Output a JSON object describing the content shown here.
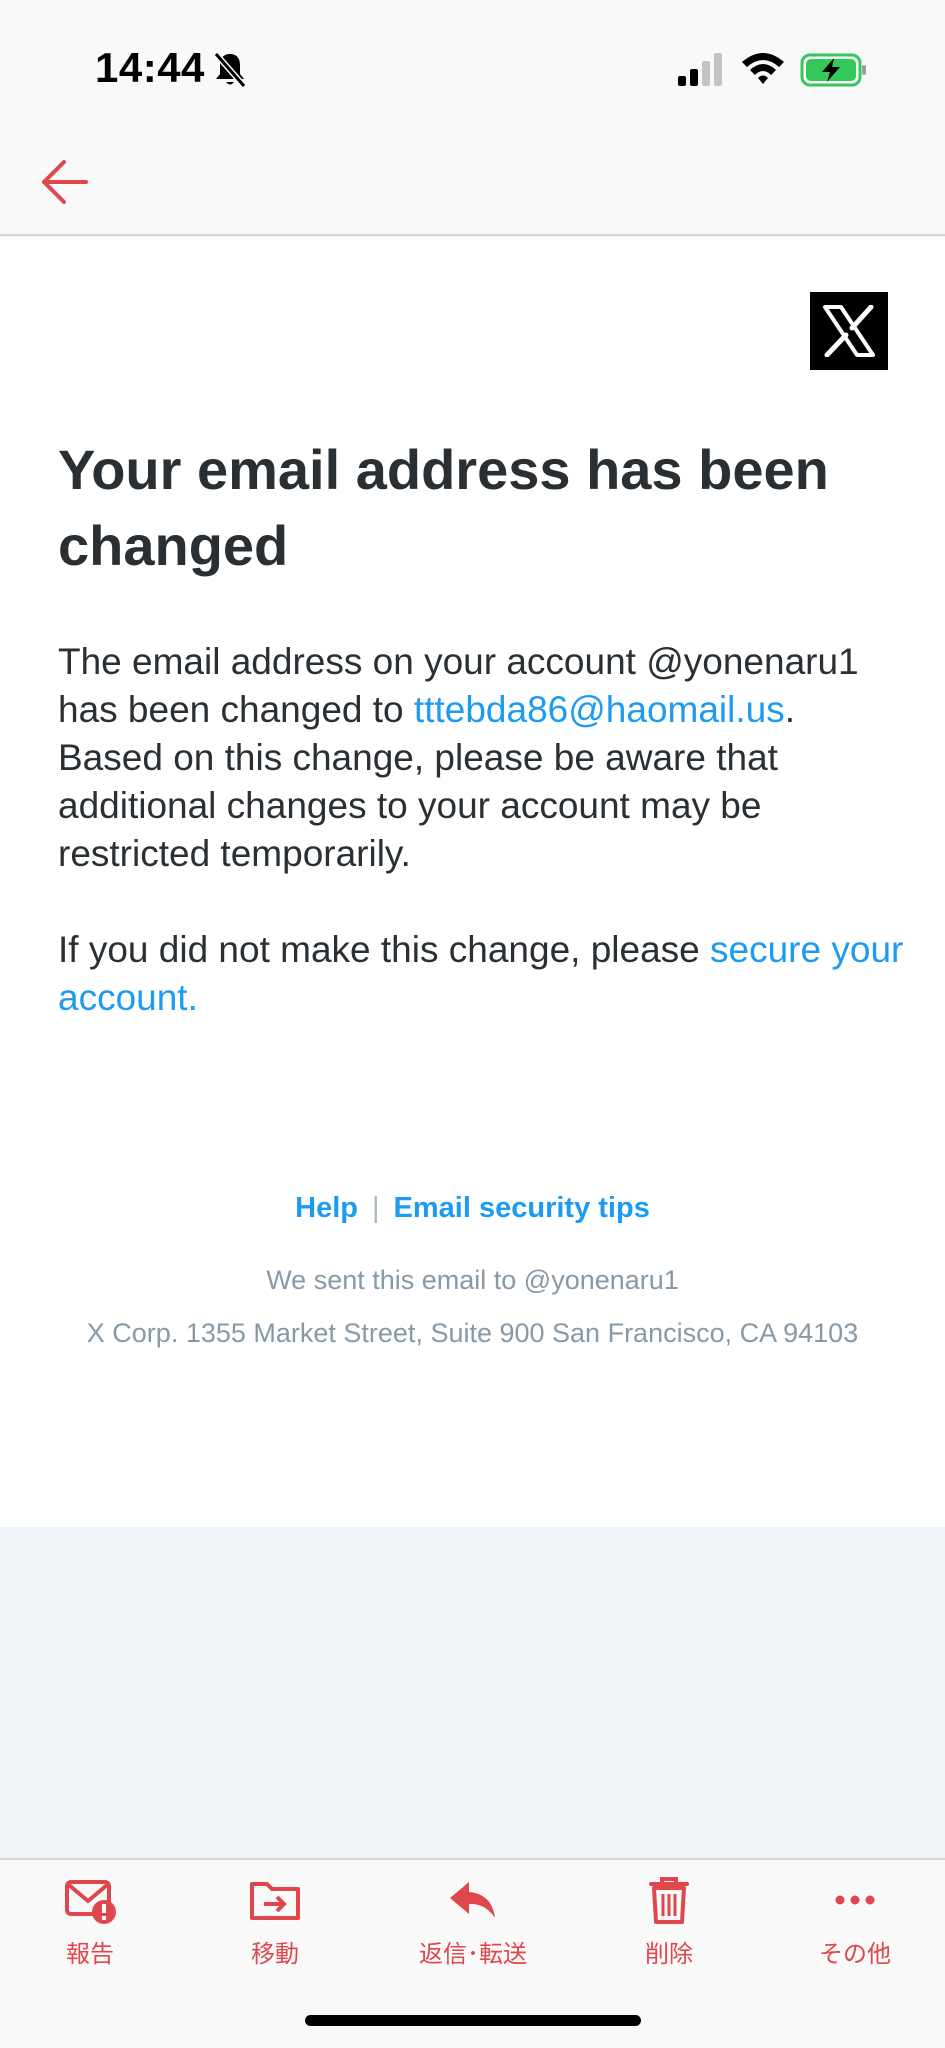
{
  "status_bar": {
    "time": "14:44"
  },
  "nav": {
    "back_icon": "arrow-left-icon"
  },
  "email": {
    "headline": "Your email address has been changed",
    "para1_a": "The email address on your account @yonenaru1 has been changed to ",
    "para1_link": "tttebda86@haomail.us",
    "para1_b": ". Based on this change, please be aware that additional changes to your account may be restricted temporarily.",
    "para2_a": "If you did not make this change, please ",
    "para2_link": "secure your account.",
    "footer_help": "Help",
    "footer_separator": "|",
    "footer_tips": "Email security tips",
    "sent_to": "We sent this email to @yonenaru1",
    "address": "X Corp. 1355 Market Street, Suite 900 San Francisco, CA 94103"
  },
  "toolbar": {
    "report": "報告",
    "move": "移動",
    "reply": "返信･転送",
    "delete": "削除",
    "more": "その他"
  },
  "colors": {
    "accent": "#e0474c",
    "link": "#1d9bf0",
    "text": "#292f33",
    "muted": "#8899a6"
  }
}
